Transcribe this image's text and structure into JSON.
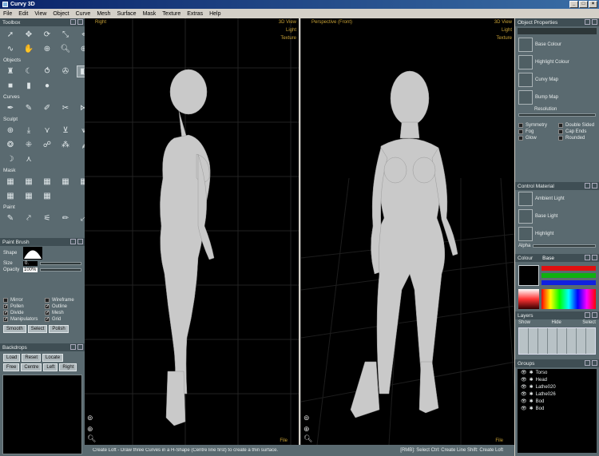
{
  "window": {
    "title": "Curvy 3D",
    "controls": [
      "_",
      "□",
      "×"
    ]
  },
  "menu": [
    "File",
    "Edit",
    "View",
    "Object",
    "Curve",
    "Mesh",
    "Surface",
    "Mask",
    "Texture",
    "Extras",
    "Help"
  ],
  "toolbox": {
    "title": "Toolbox",
    "sections": {
      "objects": "Objects",
      "curves": "Curves",
      "sculpt": "Sculpt",
      "mask": "Mask",
      "paint": "Paint"
    }
  },
  "paintbrush": {
    "title": "Paint Brush",
    "shape_label": "Shape",
    "size_label": "Size",
    "size_value": "0.",
    "opacity_label": "Opacity",
    "opacity_value": "100%"
  },
  "display_options": {
    "left": [
      {
        "label": "Mirror",
        "checked": false
      },
      {
        "label": "Pollen",
        "checked": true
      },
      {
        "label": "Divide",
        "checked": true
      },
      {
        "label": "Manipulators",
        "checked": true
      }
    ],
    "right": [
      {
        "label": "Wireframe",
        "checked": false
      },
      {
        "label": "Outline",
        "checked": true
      },
      {
        "label": "Mesh",
        "checked": true
      },
      {
        "label": "Grid",
        "checked": true
      }
    ],
    "buttons": [
      "Smooth",
      "Select",
      "Polish"
    ]
  },
  "backdrops": {
    "title": "Backdrops",
    "row1": [
      "Load",
      "Reset",
      "Locate"
    ],
    "row2": [
      "Free",
      "Centre",
      "Left",
      "Right"
    ]
  },
  "viewport_left": {
    "name": "Right",
    "top_right": [
      "3D View",
      "Light",
      "Texture"
    ],
    "file": "File"
  },
  "viewport_right": {
    "name": "Perspective (Front)",
    "top_right": [
      "3D View",
      "Light",
      "Texture"
    ],
    "file": "File"
  },
  "status": "Create Loft - Draw three Curves in a H-Shape (Centre line first) to create a thin surface.",
  "status_right": "[RMB]: Select   Ctrl: Create Line   Shift: Create Loft",
  "object_properties": {
    "title": "Object Properties",
    "items": [
      "Base Colour",
      "Highlight Colour",
      "Curvy Map",
      "Bump Map"
    ],
    "resolution": "Resolution",
    "checks_left": [
      "Symmetry",
      "Fog",
      "Glow"
    ],
    "checks_right": [
      "Double Sided",
      "Cap Ends",
      "Rounded"
    ]
  },
  "control_material": {
    "title": "Control Material",
    "items": [
      "Ambient Light",
      "Base Light",
      "Highlight"
    ],
    "alpha": "Alpha"
  },
  "colour": {
    "title": "Colour",
    "tab": "Base"
  },
  "layers": {
    "title": "Layers",
    "buttons": [
      "Show",
      "Hide",
      "Select"
    ]
  },
  "groups": {
    "title": "Groups",
    "items": [
      "Torso",
      "Head",
      "Lathe020",
      "Lathe026",
      "Bod",
      "Bod"
    ]
  }
}
